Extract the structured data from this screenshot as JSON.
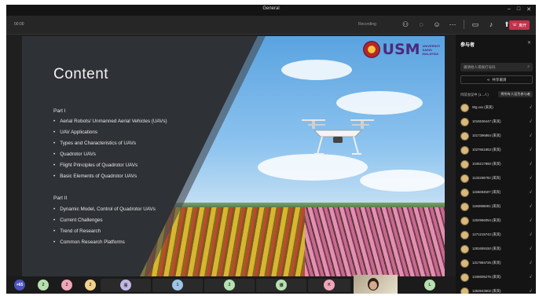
{
  "window": {
    "title": "General"
  },
  "toolbar": {
    "timer": "00:00",
    "recording_text": "Recording",
    "leave_label": "离开"
  },
  "slide": {
    "title": "Content",
    "part1": "Part I",
    "part1_items": [
      "Aerial Robots/ Unmanned Aerial Vehicles (UAVs)",
      "UAV Applications",
      "Types and Characteristics of UAVs",
      "Quadrotor UAVs",
      "Flight Principles of Quadrotor UAVs",
      "Basic Elements of Quadrotor UAVs"
    ],
    "part2": "Part II",
    "part2_items": [
      "Dynamic Model, Control of Quadrotor UAVs",
      "Current Challenges",
      "Trend of Research",
      "Common Research Platforms"
    ],
    "logo_text": "USM",
    "logo_sub": [
      "UNIVERSITI",
      "SAINS",
      "MALAYSIA"
    ]
  },
  "presenter_label": "Xu Hanx Wan",
  "sidebar": {
    "title": "参与者",
    "search_placeholder": "邀请他人或拨打号码",
    "share_label": "共享邀请",
    "section_label": "目前会议中 (1...人)",
    "admit_label": "将所有人设为参与者",
    "participants": [
      "Wg.xxx (来宾)",
      "1016636447 (来宾)",
      "1017396864 (来宾)",
      "1027661853 (来宾)",
      "1046217860 (来宾)",
      "1132269792 (来宾)",
      "1156694507 (来宾)",
      "1184856691 (来宾)",
      "1204966054 (来宾)",
      "1271215742 (来宾)",
      "1281659150 (来宾)",
      "1317994725 (来宾)",
      "1346605275 (来宾)",
      "1353943602 (来宾)"
    ]
  },
  "bottom": {
    "more_count": "+65",
    "avatars": [
      "2",
      "2",
      "2",
      "易",
      "1",
      "2",
      "谭",
      "K",
      "L"
    ],
    "colors": {
      "more": "#4b53bc",
      "blue": "#9ec3e8",
      "pink": "#f0a6b8",
      "yellow": "#f2d28a",
      "green": "#b7e0b0",
      "lilac": "#c2b7e6"
    }
  }
}
